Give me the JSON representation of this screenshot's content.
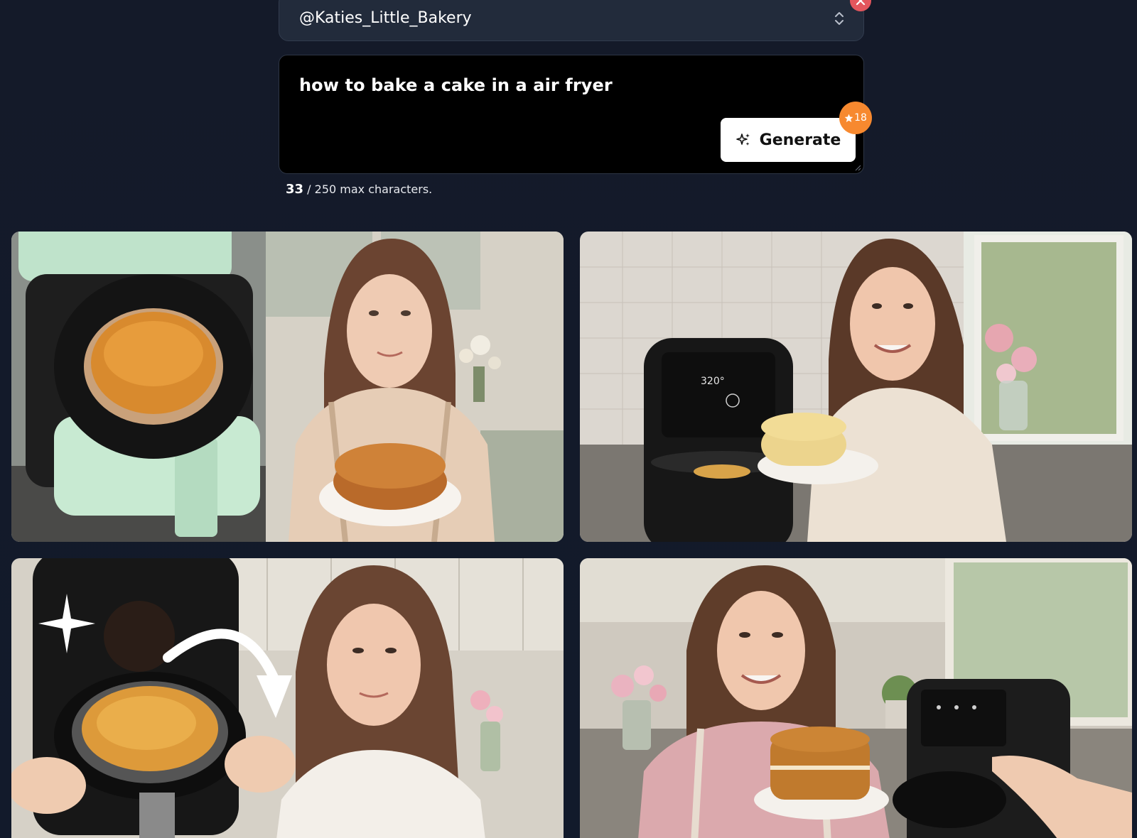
{
  "account": {
    "name": "@Katies_Little_Bakery"
  },
  "prompt": {
    "text": "how to bake a cake in a air fryer"
  },
  "generate": {
    "label": "Generate",
    "credits": "18"
  },
  "char_counter": {
    "current": "33",
    "suffix": "/ 250 max characters."
  },
  "results": [
    {
      "icon": "cake-air-fryer-image"
    },
    {
      "icon": "cake-air-fryer-image"
    },
    {
      "icon": "cake-air-fryer-image"
    },
    {
      "icon": "cake-air-fryer-image"
    }
  ],
  "colors": {
    "background": "#141a29",
    "badge": "#f7892f",
    "close": "#e3565d"
  }
}
